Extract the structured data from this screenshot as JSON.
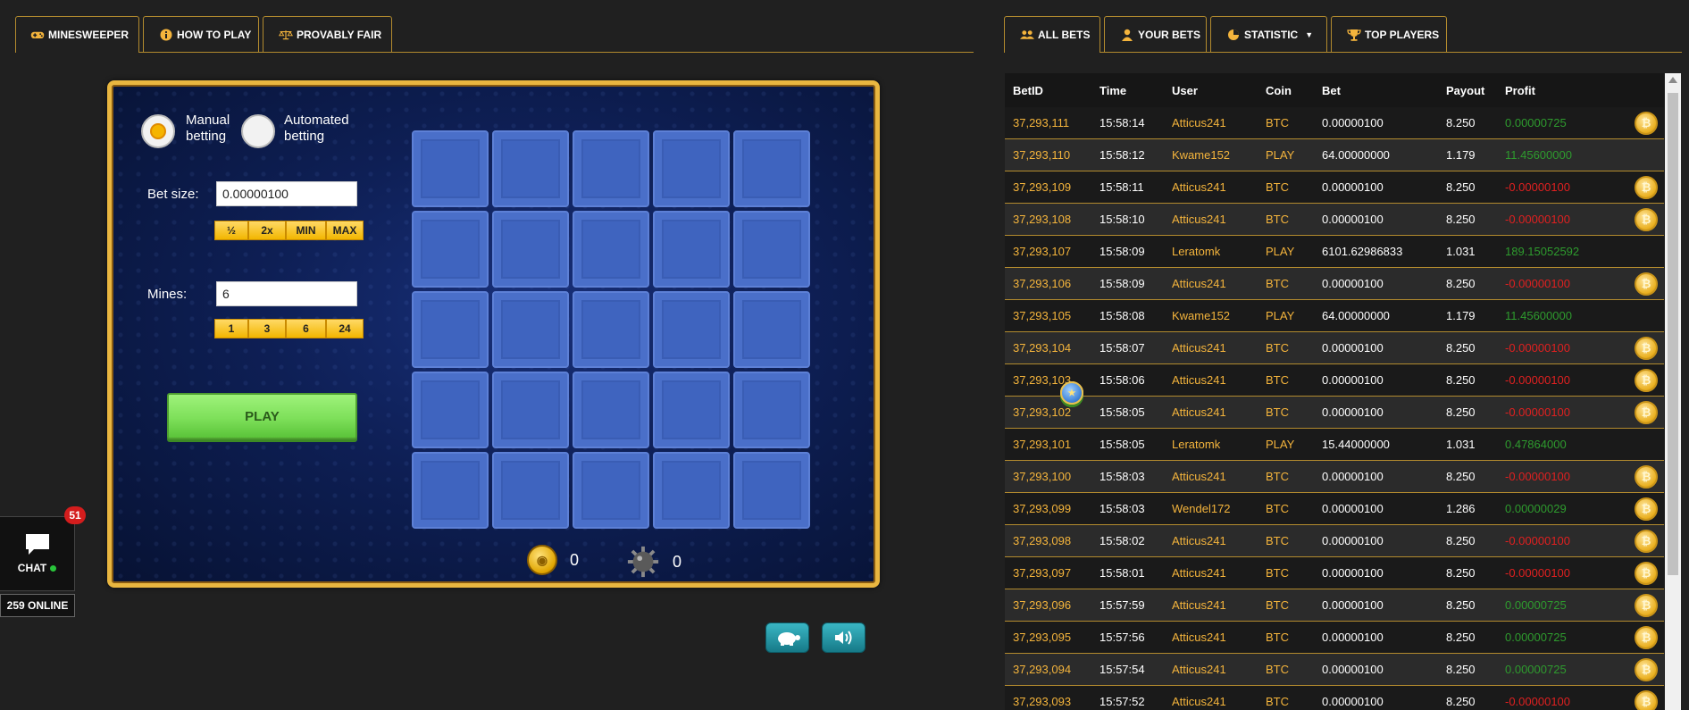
{
  "left_tabs": [
    {
      "label": "MINESWEEPER",
      "icon": "gamepad-icon",
      "active": true
    },
    {
      "label": "HOW TO PLAY",
      "icon": "info-icon",
      "active": false
    },
    {
      "label": "PROVABLY FAIR",
      "icon": "scale-icon",
      "active": false
    }
  ],
  "right_tabs": [
    {
      "label": "ALL BETS",
      "icon": "users-icon",
      "active": true
    },
    {
      "label": "YOUR BETS",
      "icon": "user-icon",
      "active": false
    },
    {
      "label": "STATISTIC",
      "icon": "pie-chart-icon",
      "active": false,
      "dropdown": true
    },
    {
      "label": "TOP PLAYERS",
      "icon": "trophy-icon",
      "active": false
    }
  ],
  "game": {
    "mode_manual": "Manual betting",
    "mode_manual_l1": "Manual",
    "mode_manual_l2": "betting",
    "mode_auto_l1": "Automated",
    "mode_auto_l2": "betting",
    "selected_mode": "manual",
    "bet_size_label": "Bet size:",
    "bet_size_value": "0.00000100",
    "bet_buttons": [
      "½",
      "2x",
      "MIN",
      "MAX"
    ],
    "mines_label": "Mines:",
    "mines_value": "6",
    "mines_buttons": [
      "1",
      "3",
      "6",
      "24"
    ],
    "play_label": "PLAY",
    "coins_found": "0",
    "mines_hit": "0",
    "tiles": 25
  },
  "chat": {
    "label": "CHAT",
    "unread": "51",
    "online": "259 ONLINE",
    "status_color": "#29c43b"
  },
  "bets_table": {
    "columns": [
      "BetID",
      "Time",
      "User",
      "Coin",
      "Bet",
      "Payout",
      "Profit"
    ],
    "rows": [
      {
        "id": "37,293,111",
        "time": "15:58:14",
        "user": "Atticus241",
        "coin": "BTC",
        "bet": "0.00000100",
        "payout": "8.250",
        "profit": "0.00000725",
        "sign": "pos"
      },
      {
        "id": "37,293,110",
        "time": "15:58:12",
        "user": "Kwame152",
        "coin": "PLAY",
        "bet": "64.00000000",
        "payout": "1.179",
        "profit": "11.45600000",
        "sign": "pos"
      },
      {
        "id": "37,293,109",
        "time": "15:58:11",
        "user": "Atticus241",
        "coin": "BTC",
        "bet": "0.00000100",
        "payout": "8.250",
        "profit": "-0.00000100",
        "sign": "neg"
      },
      {
        "id": "37,293,108",
        "time": "15:58:10",
        "user": "Atticus241",
        "coin": "BTC",
        "bet": "0.00000100",
        "payout": "8.250",
        "profit": "-0.00000100",
        "sign": "neg"
      },
      {
        "id": "37,293,107",
        "time": "15:58:09",
        "user": "Leratomk",
        "coin": "PLAY",
        "bet": "6101.62986833",
        "payout": "1.031",
        "profit": "189.15052592",
        "sign": "pos"
      },
      {
        "id": "37,293,106",
        "time": "15:58:09",
        "user": "Atticus241",
        "coin": "BTC",
        "bet": "0.00000100",
        "payout": "8.250",
        "profit": "-0.00000100",
        "sign": "neg"
      },
      {
        "id": "37,293,105",
        "time": "15:58:08",
        "user": "Kwame152",
        "coin": "PLAY",
        "bet": "64.00000000",
        "payout": "1.179",
        "profit": "11.45600000",
        "sign": "pos"
      },
      {
        "id": "37,293,104",
        "time": "15:58:07",
        "user": "Atticus241",
        "coin": "BTC",
        "bet": "0.00000100",
        "payout": "8.250",
        "profit": "-0.00000100",
        "sign": "neg"
      },
      {
        "id": "37,293,103",
        "time": "15:58:06",
        "user": "Atticus241",
        "coin": "BTC",
        "bet": "0.00000100",
        "payout": "8.250",
        "profit": "-0.00000100",
        "sign": "neg"
      },
      {
        "id": "37,293,102",
        "time": "15:58:05",
        "user": "Atticus241",
        "coin": "BTC",
        "bet": "0.00000100",
        "payout": "8.250",
        "profit": "-0.00000100",
        "sign": "neg"
      },
      {
        "id": "37,293,101",
        "time": "15:58:05",
        "user": "Leratomk",
        "coin": "PLAY",
        "bet": "15.44000000",
        "payout": "1.031",
        "profit": "0.47864000",
        "sign": "pos"
      },
      {
        "id": "37,293,100",
        "time": "15:58:03",
        "user": "Atticus241",
        "coin": "BTC",
        "bet": "0.00000100",
        "payout": "8.250",
        "profit": "-0.00000100",
        "sign": "neg"
      },
      {
        "id": "37,293,099",
        "time": "15:58:03",
        "user": "Wendel172",
        "coin": "BTC",
        "bet": "0.00000100",
        "payout": "1.286",
        "profit": "0.00000029",
        "sign": "pos"
      },
      {
        "id": "37,293,098",
        "time": "15:58:02",
        "user": "Atticus241",
        "coin": "BTC",
        "bet": "0.00000100",
        "payout": "8.250",
        "profit": "-0.00000100",
        "sign": "neg"
      },
      {
        "id": "37,293,097",
        "time": "15:58:01",
        "user": "Atticus241",
        "coin": "BTC",
        "bet": "0.00000100",
        "payout": "8.250",
        "profit": "-0.00000100",
        "sign": "neg"
      },
      {
        "id": "37,293,096",
        "time": "15:57:59",
        "user": "Atticus241",
        "coin": "BTC",
        "bet": "0.00000100",
        "payout": "8.250",
        "profit": "0.00000725",
        "sign": "pos"
      },
      {
        "id": "37,293,095",
        "time": "15:57:56",
        "user": "Atticus241",
        "coin": "BTC",
        "bet": "0.00000100",
        "payout": "8.250",
        "profit": "0.00000725",
        "sign": "pos"
      },
      {
        "id": "37,293,094",
        "time": "15:57:54",
        "user": "Atticus241",
        "coin": "BTC",
        "bet": "0.00000100",
        "payout": "8.250",
        "profit": "0.00000725",
        "sign": "pos"
      },
      {
        "id": "37,293,093",
        "time": "15:57:52",
        "user": "Atticus241",
        "coin": "BTC",
        "bet": "0.00000100",
        "payout": "8.250",
        "profit": "-0.00000100",
        "sign": "neg"
      }
    ]
  },
  "colors": {
    "accent_gold": "#b38b2e",
    "link_gold": "#f4b43c",
    "profit_positive": "#2e9b2e",
    "profit_negative": "#e02020",
    "play_green": "#7ee05a"
  }
}
